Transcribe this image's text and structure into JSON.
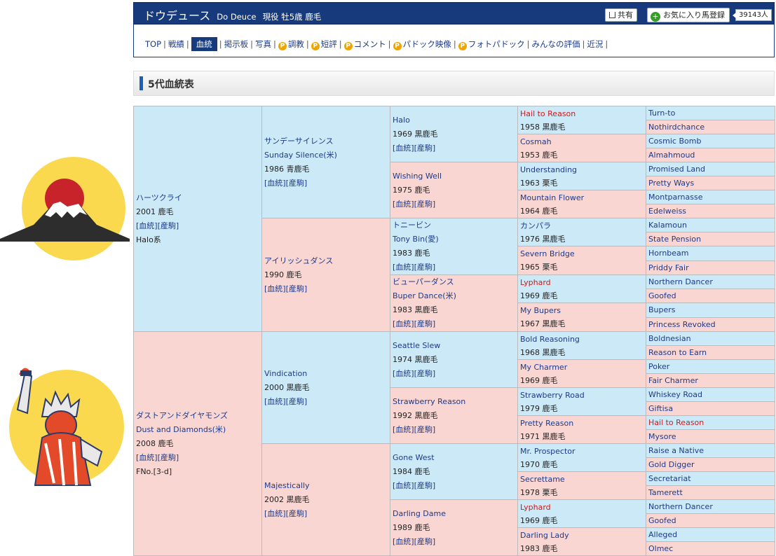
{
  "header": {
    "title": "ドウデュース",
    "sub": "Do Deuce",
    "status": "現役 牡5歳 鹿毛",
    "share": "共有",
    "fav": "お気に入り馬登録",
    "fav_count": "39143人"
  },
  "nav": [
    "TOP",
    "戦績",
    "血統",
    "掲示板",
    "写真",
    "調教",
    "短評",
    "コメント",
    "パドック映像",
    "フォトパドック",
    "みんなの評価",
    "近況"
  ],
  "section_title": "5代血統表",
  "links": {
    "bloodline": "[血統]",
    "sales": "[産駒]"
  },
  "g1": [
    {
      "name": "ハーツクライ",
      "year": "2001 鹿毛",
      "extra": "Halo系"
    },
    {
      "name": "ダストアンドダイヤモンズ",
      "name_en": "Dust and Diamonds(米)",
      "year": "2008 鹿毛",
      "extra": "FNo.[3-d]"
    }
  ],
  "g2": [
    {
      "name": "サンデーサイレンス",
      "name_en": "Sunday Silence(米)",
      "year": "1986 青鹿毛"
    },
    {
      "name": "アイリッシュダンス",
      "year": "1990 鹿毛"
    },
    {
      "name": "Vindication",
      "year": "2000 黒鹿毛"
    },
    {
      "name": "Majestically",
      "year": "2002 黒鹿毛"
    }
  ],
  "g3": [
    {
      "name": "Halo",
      "year": "1969 黒鹿毛"
    },
    {
      "name": "Wishing Well",
      "year": "1975 鹿毛"
    },
    {
      "name": "トニービン",
      "name_en": "Tony Bin(愛)",
      "year": "1983 鹿毛"
    },
    {
      "name": "ビューパーダンス",
      "name_en": "Buper Dance(米)",
      "year": "1983 黒鹿毛"
    },
    {
      "name": "Seattle Slew",
      "year": "1974 黒鹿毛"
    },
    {
      "name": "Strawberry Reason",
      "year": "1992 黒鹿毛"
    },
    {
      "name": "Gone West",
      "year": "1984 鹿毛"
    },
    {
      "name": "Darling Dame",
      "year": "1989 鹿毛"
    }
  ],
  "g4": [
    {
      "name": "Hail to Reason",
      "year": "1958 黒鹿毛",
      "red": true
    },
    {
      "name": "Cosmah",
      "year": "1953 鹿毛"
    },
    {
      "name": "Understanding",
      "year": "1963 栗毛"
    },
    {
      "name": "Mountain Flower",
      "year": "1964 鹿毛"
    },
    {
      "name": "カンパラ",
      "year": "1976 黒鹿毛"
    },
    {
      "name": "Severn Bridge",
      "year": "1965 栗毛"
    },
    {
      "name": "Lyphard",
      "year": "1969 鹿毛",
      "red": true
    },
    {
      "name": "My Bupers",
      "year": "1967 黒鹿毛"
    },
    {
      "name": "Bold Reasoning",
      "year": "1968 黒鹿毛"
    },
    {
      "name": "My Charmer",
      "year": "1969 鹿毛"
    },
    {
      "name": "Strawberry Road",
      "year": "1979 鹿毛"
    },
    {
      "name": "Pretty Reason",
      "year": "1971 黒鹿毛"
    },
    {
      "name": "Mr. Prospector",
      "year": "1970 鹿毛"
    },
    {
      "name": "Secrettame",
      "year": "1978 栗毛"
    },
    {
      "name": "Lyphard",
      "year": "1969 鹿毛",
      "red": true
    },
    {
      "name": "Darling Lady",
      "year": "1983 鹿毛"
    }
  ],
  "g5": [
    "Turn-to",
    "Nothirdchance",
    "Cosmic Bomb",
    "Almahmoud",
    "Promised Land",
    "Pretty Ways",
    "Montparnasse",
    "Edelweiss",
    "Kalamoun",
    "State Pension",
    "Hornbeam",
    "Priddy Fair",
    "Northern Dancer",
    "Goofed",
    "Bupers",
    "Princess Revoked",
    "Boldnesian",
    "Reason to Earn",
    "Poker",
    "Fair Charmer",
    "Whiskey Road",
    "Giftisa",
    "Hail to Reason",
    "Mysore",
    "Raise a Native",
    "Gold Digger",
    "Secretariat",
    "Tamerett",
    "Northern Dancer",
    "Goofed",
    "Alleged",
    "Olmec"
  ],
  "g5_red": [
    22
  ],
  "colors": {
    "male": "#cce9f7",
    "female": "#f9d6d2",
    "header": "#163a7c"
  },
  "icons": [
    "mount-fuji-icon",
    "statue-of-liberty-icon"
  ]
}
